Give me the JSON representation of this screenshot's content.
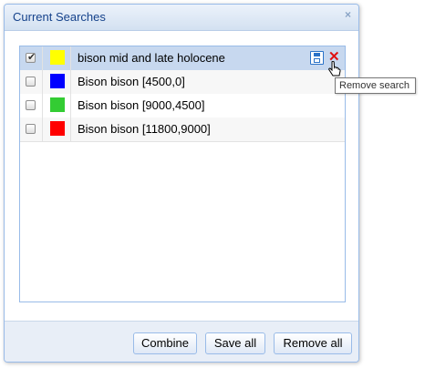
{
  "dialog": {
    "title": "Current Searches",
    "close_glyph": "×"
  },
  "rows": [
    {
      "name": "bison mid and late holocene",
      "color": "#ffff00",
      "checked": true,
      "selected": true
    },
    {
      "name": "Bison bison [4500,0]",
      "color": "#0000ff",
      "checked": false,
      "selected": false
    },
    {
      "name": "Bison bison [9000,4500]",
      "color": "#33cc33",
      "checked": false,
      "selected": false
    },
    {
      "name": "Bison bison [11800,9000]",
      "color": "#ff0000",
      "checked": false,
      "selected": false
    }
  ],
  "row_actions": {
    "save_icon": "save-icon",
    "remove_icon": "remove-icon",
    "remove_glyph": "✕"
  },
  "tooltip": {
    "text": "Remove search"
  },
  "footer": {
    "combine_label": "Combine",
    "save_all_label": "Save all",
    "remove_all_label": "Remove all"
  },
  "colors": {
    "title_text": "#15428b",
    "border": "#99bbe8",
    "selected_row": "#c7d8ef"
  }
}
